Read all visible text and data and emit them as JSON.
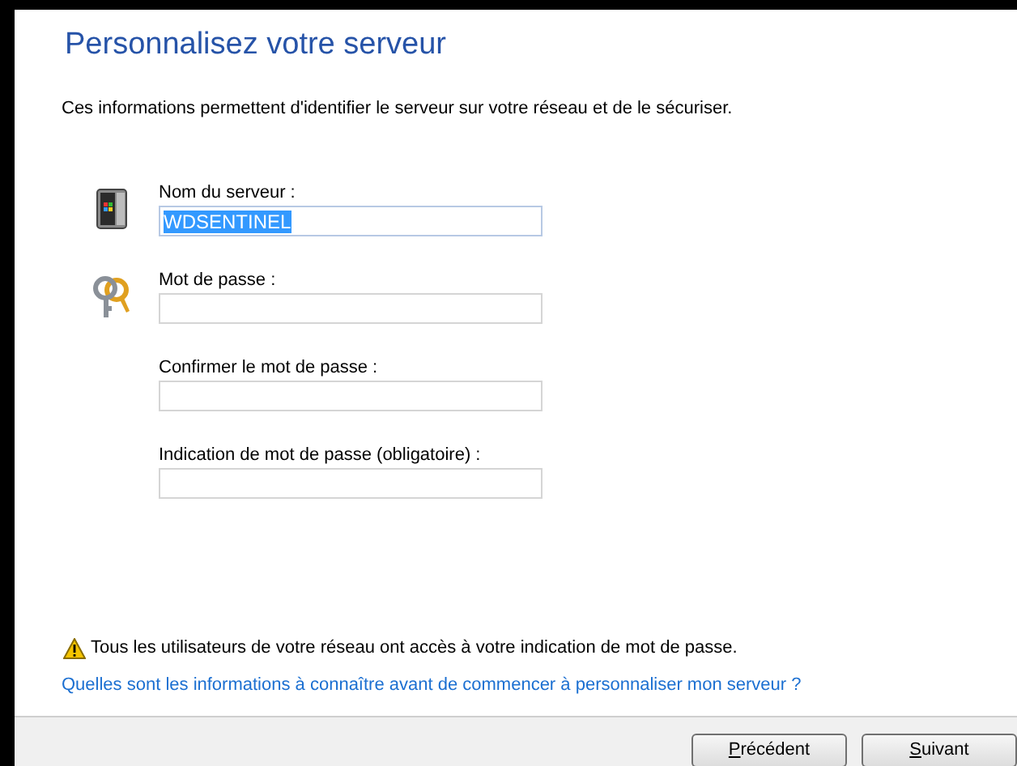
{
  "title": "Personnalisez votre serveur",
  "description": "Ces informations permettent d'identifier le serveur sur votre réseau et de le sécuriser.",
  "fields": [
    {
      "kind": "server",
      "label": "Nom du serveur :",
      "value": "WDSENTINEL",
      "selected": true
    },
    {
      "kind": "key",
      "label": "Mot de passe :",
      "selected": false
    },
    {
      "kind": "plain",
      "label": "Confirmer le mot de passe :",
      "selected": false
    },
    {
      "kind": "plain",
      "label": "Indication de mot de passe (obligatoire) :",
      "selected": false
    }
  ],
  "warning": "Tous les utilisateurs de votre réseau ont accès à votre indication de mot de passe.",
  "help_link": "Quelles sont les informations à connaître avant de commencer à personnaliser mon serveur ?",
  "buttons": [
    {
      "label": "Précédent",
      "first_letter_underlined": true
    },
    {
      "label": "Suivant",
      "first_letter_underlined": true
    }
  ]
}
